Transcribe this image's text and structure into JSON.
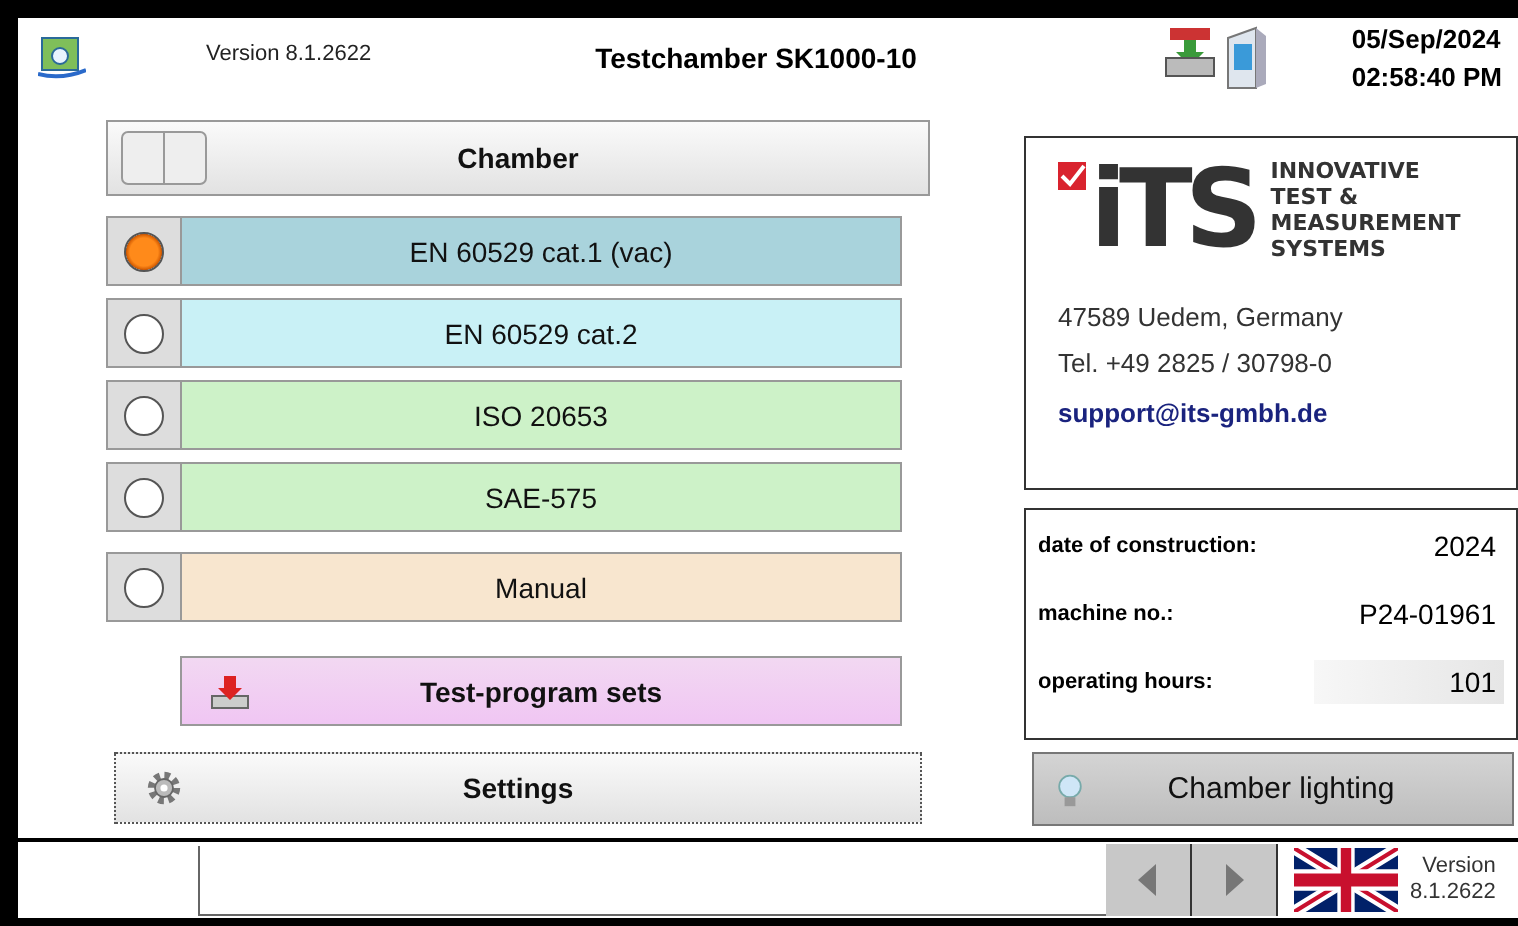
{
  "header": {
    "version": "Version 8.1.2622",
    "title": "Testchamber  SK1000-10",
    "date": "05/Sep/2024",
    "time": "02:58:40 PM"
  },
  "chamber_button": {
    "label": "Chamber"
  },
  "modes": [
    {
      "label": "EN 60529 cat.1 (vac)",
      "selected": true,
      "color": "#a9d3dc"
    },
    {
      "label": "EN 60529 cat.2",
      "selected": false,
      "color": "#c9f1f6"
    },
    {
      "label": "ISO 20653",
      "selected": false,
      "color": "#cdf2c8"
    },
    {
      "label": "SAE-575",
      "selected": false,
      "color": "#cdf2c8"
    },
    {
      "label": "Manual",
      "selected": false,
      "color": "#f8e6cf"
    }
  ],
  "test_program_button": {
    "label": "Test-program sets"
  },
  "settings_button": {
    "label": "Settings"
  },
  "company": {
    "mark": "iTS",
    "tagline": [
      "INNOVATIVE",
      "TEST &",
      "MEASUREMENT",
      "SYSTEMS"
    ],
    "address": "47589 Uedem, Germany",
    "phone": "Tel. +49 2825 / 30798-0",
    "email": "support@its-gmbh.de"
  },
  "machine_info": [
    {
      "label": "date of construction:",
      "value": "2024",
      "highlighted": false
    },
    {
      "label": "machine no.:",
      "value": "P24-01961",
      "highlighted": false
    },
    {
      "label": "operating hours:",
      "value": "101",
      "highlighted": true
    }
  ],
  "lighting_button": {
    "label": "Chamber lighting"
  },
  "footer": {
    "version_label": "Version",
    "version_number": "8.1.2622"
  }
}
